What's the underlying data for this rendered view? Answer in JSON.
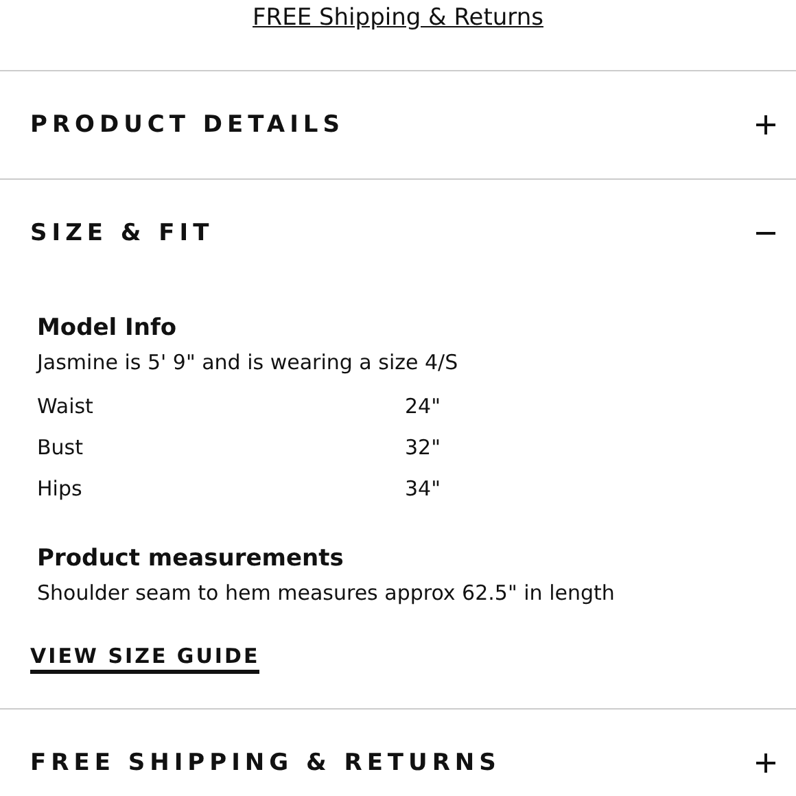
{
  "shipping_link": "FREE Shipping & Returns",
  "sections": [
    {
      "title": "PRODUCT DETAILS",
      "expanded": false
    },
    {
      "title": "SIZE & FIT",
      "expanded": true,
      "content": {
        "model_info": {
          "heading": "Model Info",
          "text": "Jasmine is 5' 9\" and is wearing a size 4/S",
          "rows": [
            {
              "label": "Waist",
              "value": "24\""
            },
            {
              "label": "Bust",
              "value": "32\""
            },
            {
              "label": "Hips",
              "value": "34\""
            }
          ]
        },
        "product_measurements": {
          "heading": "Product measurements",
          "text": "Shoulder seam to hem measures approx 62.5\" in length"
        },
        "link": "VIEW SIZE GUIDE"
      }
    },
    {
      "title": "FREE SHIPPING & RETURNS",
      "expanded": false
    }
  ]
}
